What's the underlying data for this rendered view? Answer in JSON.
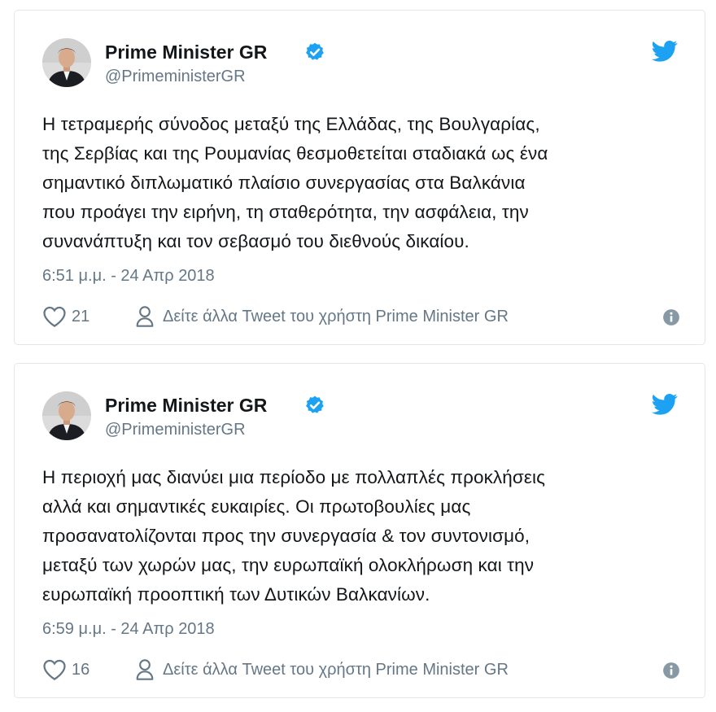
{
  "tweets": [
    {
      "author": {
        "name": "Prime Minister GR",
        "handle": "@PrimeministerGR",
        "verified": true
      },
      "text_lines": [
        "Η τετραμερής σύνοδος μεταξύ της Ελλάδας, της Βουλγαρίας,",
        "της Σερβίας και της Ρουμανίας θεσμοθετείται σταδιακά ως ένα",
        "σημαντικό διπλωματικό πλαίσιο συνεργασίας στα Βαλκάνια",
        "που προάγει την ειρήνη, τη σταθερότητα, την ασφάλεια, την",
        "συνανάπτυξη και τον σεβασμό του διεθνούς δικαίου."
      ],
      "timestamp": "6:51 μ.μ. - 24 Απρ 2018",
      "likes": "21",
      "more_label": "Δείτε άλλα Tweet του χρήστη Prime Minister GR"
    },
    {
      "author": {
        "name": "Prime Minister GR",
        "handle": "@PrimeministerGR",
        "verified": true
      },
      "text_lines": [
        "Η περιοχή μας διανύει μια περίοδο με πολλαπλές προκλήσεις",
        "αλλά και σημαντικές ευκαιρίες. Οι πρωτοβουλίες μας",
        "προσανατολίζονται προς την συνεργασία & τον συντονισμό,",
        "μεταξύ των χωρών μας, την ευρωπαϊκή ολοκλήρωση και την",
        "ευρωπαϊκή προοπτική των Δυτικών Βαλκανίων."
      ],
      "timestamp": "6:59 μ.μ. - 24 Απρ 2018",
      "likes": "16",
      "more_label": "Δείτε άλλα Tweet του χρήστη Prime Minister GR"
    }
  ],
  "icons": {
    "brand": "twitter-bird-icon",
    "verified": "verified-badge-icon",
    "like": "heart-icon",
    "more": "person-icon",
    "info": "info-icon"
  },
  "colors": {
    "twitter_blue": "#1da1f2",
    "muted_text": "#657786",
    "body_text": "#14171a",
    "border": "#e1e8ed"
  }
}
